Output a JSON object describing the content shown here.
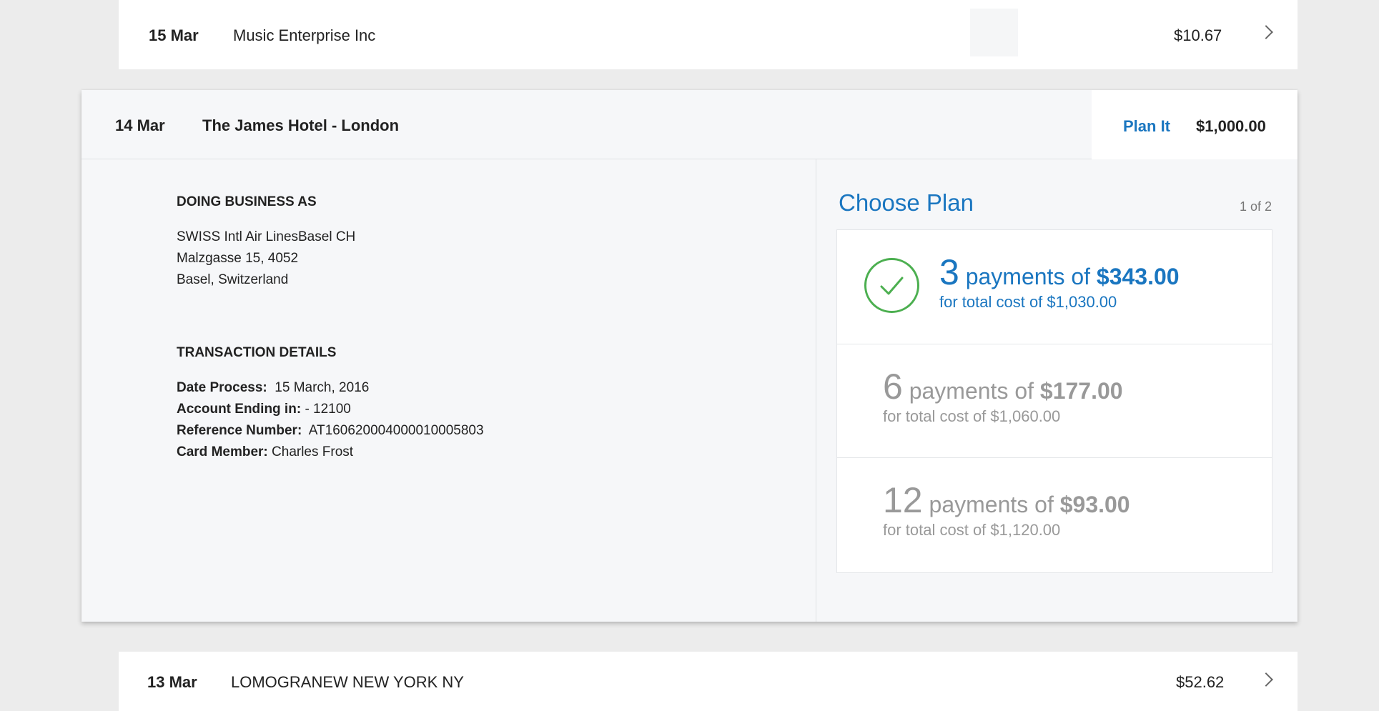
{
  "rows": {
    "top": {
      "date": "15 Mar",
      "merchant": "Music Enterprise Inc",
      "amount": "$10.67"
    },
    "bottom": {
      "date": "13 Mar",
      "merchant": "LOMOGRANEW NEW YORK NY",
      "amount": "$52.62"
    }
  },
  "expanded": {
    "date": "14 Mar",
    "merchant": "The James Hotel - London",
    "plan_it_label": "Plan It",
    "amount": "$1,000.00",
    "dba": {
      "title": "DOING BUSINESS AS",
      "lines": [
        "SWISS Intl Air LinesBasel CH",
        "Malzgasse 15, 4052",
        "Basel, Switzerland"
      ]
    },
    "details": {
      "title": "TRANSACTION DETAILS",
      "date_label": "Date Process:",
      "date_value": "15 March, 2016",
      "account_label": "Account Ending in:",
      "account_value": "- 12100",
      "reference_label": "Reference Number:",
      "reference_value": "AT160620004000010005803",
      "member_label": "Card Member:",
      "member_value": "Charles Frost"
    },
    "choose_plan": {
      "title": "Choose Plan",
      "pager": "1 of 2",
      "plans": [
        {
          "count": "3",
          "middle": " payments of ",
          "price": "$343.00",
          "total": "for total cost of $1,030.00",
          "selected": true
        },
        {
          "count": "6",
          "middle": " payments of ",
          "price": "$177.00",
          "total": "for total cost of $1,060.00",
          "selected": false
        },
        {
          "count": "12",
          "middle": " payments of ",
          "price": "$93.00",
          "total": "for total cost of $1,120.00",
          "selected": false
        }
      ]
    }
  },
  "icons": {
    "row_arrow": "chevron-right-icon",
    "selected_plan": "check-circle-icon"
  },
  "colors": {
    "accent": "#1a76c0",
    "check": "#4caf50",
    "muted": "#999999",
    "background": "#ececec"
  }
}
